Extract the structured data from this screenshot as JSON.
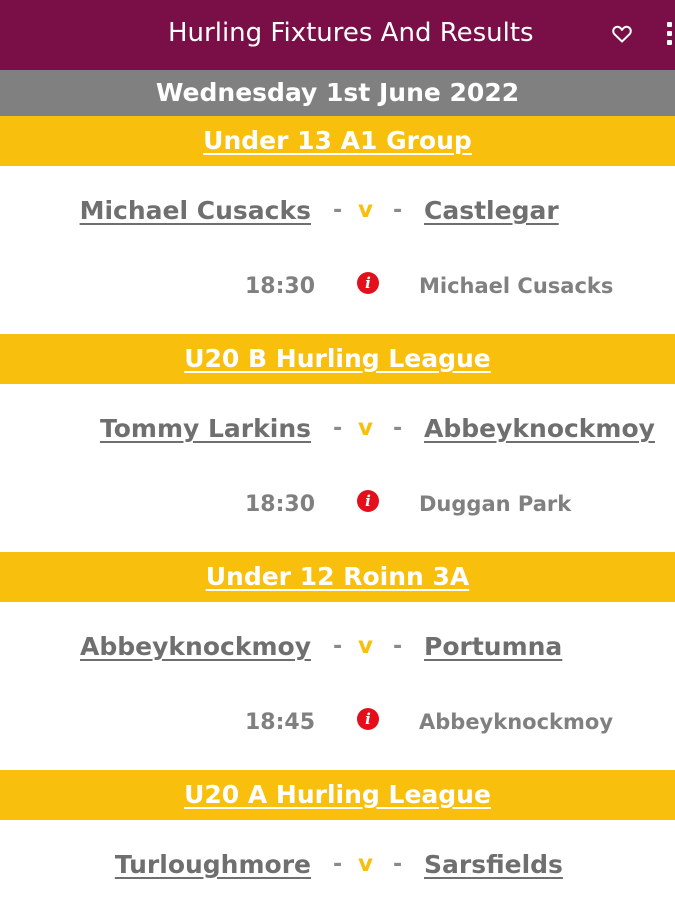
{
  "header": {
    "title": "Hurling Fixtures And Results",
    "favorite_icon": "heart-outline-icon",
    "menu_icon": "more-vertical-icon"
  },
  "date_label": "Wednesday 1st June 2022",
  "colors": {
    "header_bg": "#7a0e46",
    "date_bar_bg": "#808080",
    "group_bar_bg": "#f9bf0d",
    "info_icon": "#e3101b",
    "team_text": "#6f6f6f"
  },
  "groups": [
    {
      "name": "Under 13 A1 Group",
      "fixture": {
        "home": "Michael Cusacks",
        "separator": "v",
        "away": "Castlegar",
        "time": "18:30",
        "venue": "Michael Cusacks"
      }
    },
    {
      "name": "U20 B Hurling League",
      "fixture": {
        "home": "Tommy Larkins",
        "separator": "v",
        "away": "Abbeyknockmoy",
        "time": "18:30",
        "venue": "Duggan Park"
      }
    },
    {
      "name": "Under 12 Roinn 3A",
      "fixture": {
        "home": "Abbeyknockmoy",
        "separator": "v",
        "away": "Portumna",
        "time": "18:45",
        "venue": "Abbeyknockmoy"
      }
    },
    {
      "name": "U20 A Hurling League",
      "fixture": {
        "home": "Turloughmore",
        "separator": "v",
        "away": "Sarsfields",
        "time": "",
        "venue": ""
      }
    }
  ]
}
